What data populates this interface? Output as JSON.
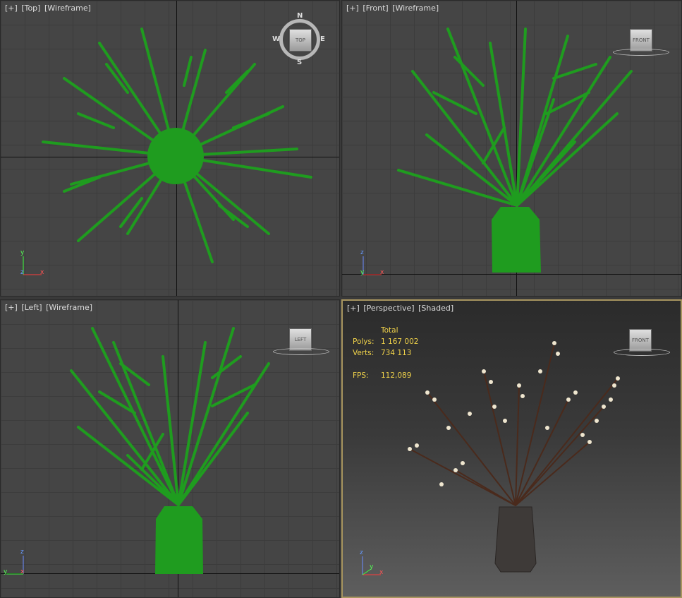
{
  "viewports": {
    "top": {
      "bracket": "[+]",
      "view": "[Top]",
      "mode": "[Wireframe]"
    },
    "front": {
      "bracket": "[+]",
      "view": "[Front]",
      "mode": "[Wireframe]"
    },
    "left": {
      "bracket": "[+]",
      "view": "[Left]",
      "mode": "[Wireframe]"
    },
    "perspective": {
      "bracket": "[+]",
      "view": "[Perspective]",
      "mode": "[Shaded]"
    }
  },
  "viewcube": {
    "top_label": "TOP",
    "front_label": "FRONT",
    "left_label": "LEFT",
    "persp_label": "FRONT",
    "compass": {
      "n": "N",
      "s": "S",
      "e": "E",
      "w": "W"
    }
  },
  "stats": {
    "header": "Total",
    "polys_label": "Polys:",
    "polys_value": "1 167 002",
    "verts_label": "Verts:",
    "verts_value": "734 113",
    "fps_label": "FPS:",
    "fps_value": "112,089"
  },
  "gizmo_axes": {
    "x": "x",
    "y": "y",
    "z": "z"
  },
  "colors": {
    "wireframe": "#1f9c1f",
    "branch": "#4a2a1c",
    "blossom": "#efe6cf",
    "vase": "#3e3a38",
    "active_border": "#a8955f"
  }
}
